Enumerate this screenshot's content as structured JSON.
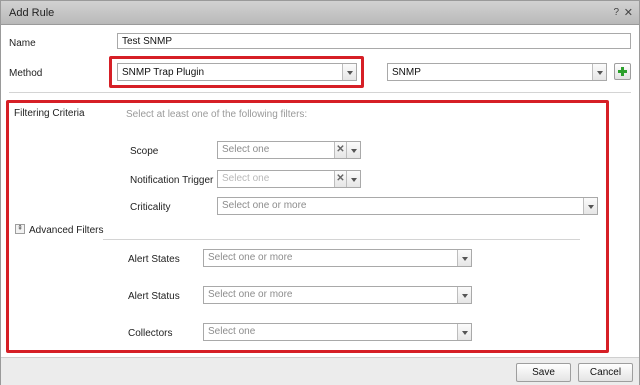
{
  "window": {
    "title": "Add Rule",
    "help_glyph": "?",
    "close_glyph": "✕"
  },
  "form": {
    "name_label": "Name",
    "name_value": "Test SNMP",
    "method_label": "Method",
    "method_value": "SNMP Trap Plugin",
    "instance_value": "SNMP"
  },
  "filtering": {
    "heading": "Filtering Criteria",
    "hint": "Select at least one of the following filters:",
    "scope_label": "Scope",
    "scope_placeholder": "Select one",
    "trigger_label": "Notification Trigger",
    "trigger_placeholder": "Select one",
    "criticality_label": "Criticality",
    "criticality_placeholder": "Select one or more",
    "clear_glyph": "✕"
  },
  "advanced": {
    "toggle_label": "Advanced Filters",
    "toggle_glyph": "⇞",
    "alert_states_label": "Alert States",
    "alert_states_placeholder": "Select one or more",
    "alert_status_label": "Alert Status",
    "alert_status_placeholder": "Select one or more",
    "collectors_label": "Collectors",
    "collectors_placeholder": "Select one"
  },
  "footer": {
    "save_label": "Save",
    "cancel_label": "Cancel"
  },
  "colors": {
    "highlight": "#d61f26",
    "add_icon": "#2ca02c"
  }
}
